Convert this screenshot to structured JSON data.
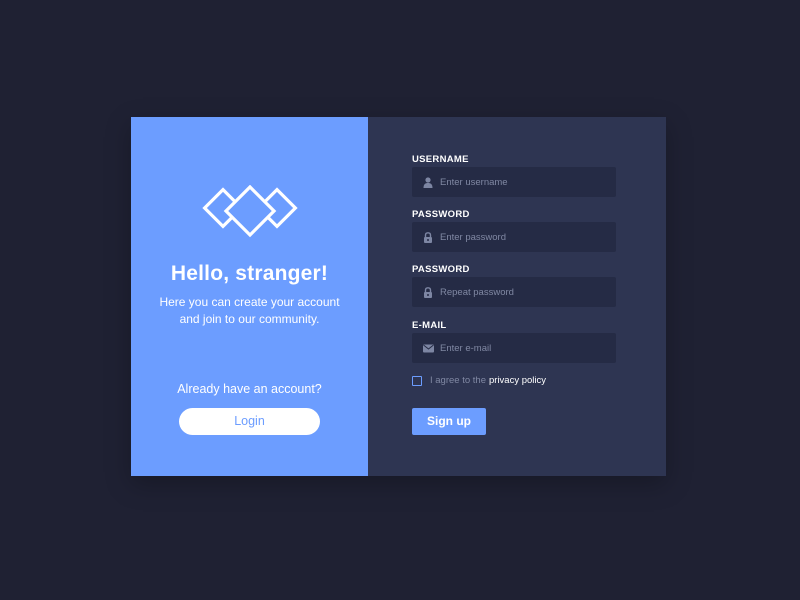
{
  "colors": {
    "background": "#1f2133",
    "left_panel": "#6c9dff",
    "right_panel": "#2e3552",
    "field_bg": "#252b45",
    "accent": "#6c9dff",
    "placeholder": "#8088a3",
    "white": "#ffffff"
  },
  "welcome": {
    "logo": "stacked-diamonds-logo",
    "title": "Hello, stranger!",
    "intro_line1": "Here you can create your account",
    "intro_line2": "and join to our community.",
    "already_text": "Already have an account?",
    "login_label": "Login"
  },
  "form": {
    "fields": [
      {
        "label": "USERNAME",
        "placeholder": "Enter username",
        "icon": "user-icon",
        "value": ""
      },
      {
        "label": "PASSWORD",
        "placeholder": "Enter password",
        "icon": "lock-icon",
        "value": ""
      },
      {
        "label": "PASSWORD",
        "placeholder": "Repeat password",
        "icon": "lock-icon",
        "value": ""
      },
      {
        "label": "E-MAIL",
        "placeholder": "Enter e-mail",
        "icon": "mail-icon",
        "value": ""
      }
    ],
    "agree_text": "I agree to the",
    "policy_link": "privacy policy",
    "agree_checked": false,
    "signup_label": "Sign up"
  }
}
